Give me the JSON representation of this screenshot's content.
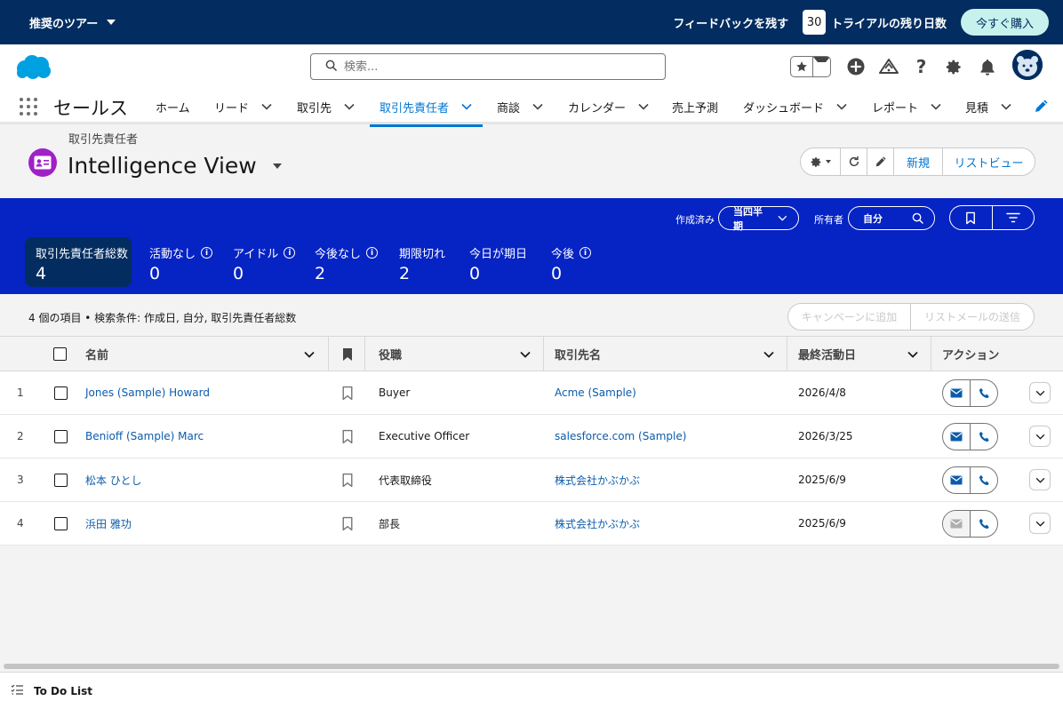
{
  "trial_bar": {
    "tours_label": "推奨のツアー",
    "feedback_label": "フィードバックを残す",
    "days_remaining": "30",
    "trial_days_label": "トライアルの残り日数",
    "buy_now_label": "今すぐ購入"
  },
  "header": {
    "search_placeholder": "検索..."
  },
  "nav": {
    "app_name": "セールス",
    "items": [
      {
        "label": "ホーム"
      },
      {
        "label": "リード"
      },
      {
        "label": "取引先"
      },
      {
        "label": "取引先責任者"
      },
      {
        "label": "商談"
      },
      {
        "label": "カレンダー"
      },
      {
        "label": "売上予測"
      },
      {
        "label": "ダッシュボード"
      },
      {
        "label": "レポート"
      },
      {
        "label": "見積"
      }
    ],
    "active_index": 3
  },
  "page": {
    "object_label": "取引先責任者",
    "view_title": "Intelligence View",
    "new_label": "新規",
    "list_view_label": "リストビュー"
  },
  "filters": {
    "created_label": "作成済み",
    "created_value": "当四半期",
    "owner_label": "所有者",
    "owner_value": "自分"
  },
  "kpis": [
    {
      "label": "取引先責任者総数",
      "value": "4",
      "info": false,
      "selected": true
    },
    {
      "label": "活動なし",
      "value": "0",
      "info": true,
      "selected": false
    },
    {
      "label": "アイドル",
      "value": "0",
      "info": true,
      "selected": false
    },
    {
      "label": "今後なし",
      "value": "2",
      "info": true,
      "selected": false
    },
    {
      "label": "期限切れ",
      "value": "2",
      "info": false,
      "selected": false
    },
    {
      "label": "今日が期日",
      "value": "0",
      "info": false,
      "selected": false
    },
    {
      "label": "今後",
      "value": "0",
      "info": true,
      "selected": false
    }
  ],
  "list": {
    "summary": "4 個の項目 • 検索条件: 作成日, 自分, 取引先責任者総数",
    "add_to_campaign_label": "キャンペーンに追加",
    "send_list_email_label": "リストメールの送信",
    "columns": {
      "name": "名前",
      "title": "役職",
      "account": "取引先名",
      "last_activity": "最終活動日",
      "actions": "アクション"
    },
    "rows": [
      {
        "num": "1",
        "name": "Jones (Sample) Howard",
        "title": "Buyer",
        "account": "Acme (Sample)",
        "last_activity": "2026/4/8",
        "email_enabled": true
      },
      {
        "num": "2",
        "name": "Benioff (Sample) Marc",
        "title": "Executive Officer",
        "account": "salesforce.com (Sample)",
        "last_activity": "2026/3/25",
        "email_enabled": true
      },
      {
        "num": "3",
        "name": "松本 ひとし",
        "title": "代表取締役",
        "account": "株式会社かぶかぶ",
        "last_activity": "2025/6/9",
        "email_enabled": true
      },
      {
        "num": "4",
        "name": "浜田 雅功",
        "title": "部長",
        "account": "株式会社かぶかぶ",
        "last_activity": "2025/6/9",
        "email_enabled": false
      }
    ]
  },
  "footer": {
    "todo_label": "To Do List"
  },
  "colors": {
    "trial_bar": "#032d60",
    "brand_blue": "#0176d3",
    "kpi_band": "#0623c4",
    "kpi_selected": "#032d60",
    "contact_icon": "#a020c8",
    "link": "#0b5cab"
  }
}
